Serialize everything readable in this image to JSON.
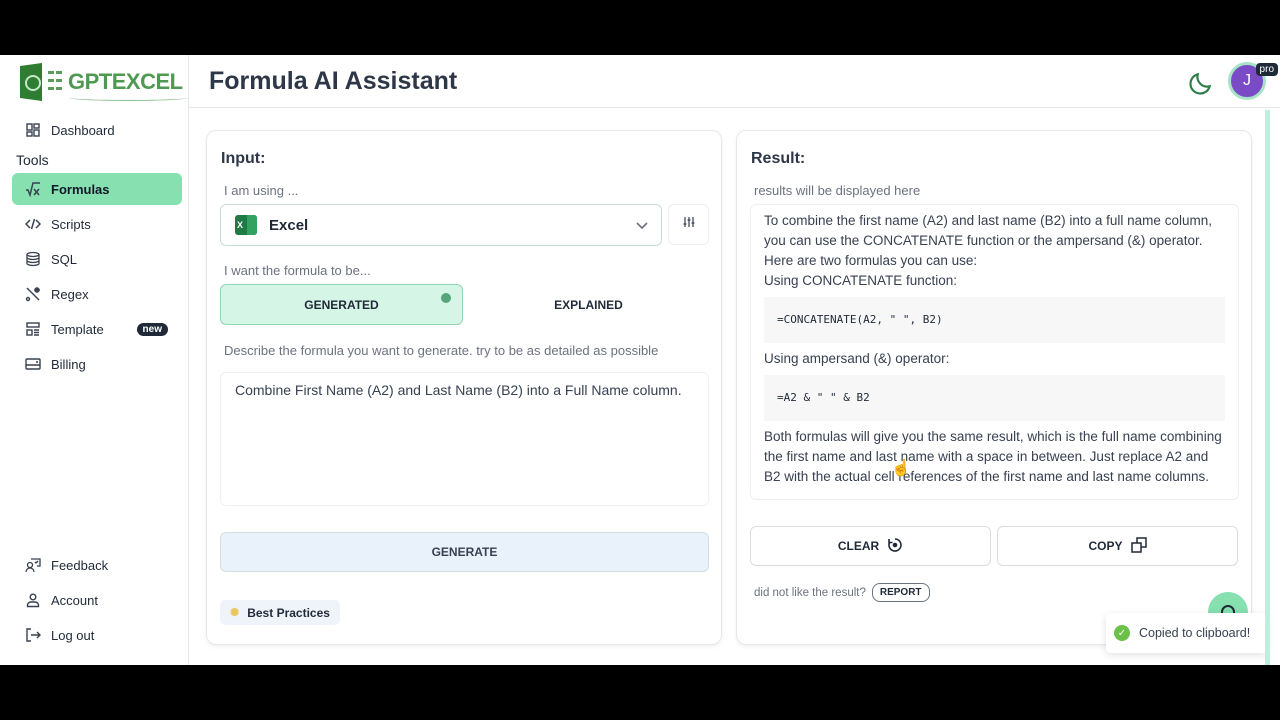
{
  "app": {
    "logo_text": "GPTEXCEL",
    "page_title": "Formula AI Assistant"
  },
  "sidebar": {
    "dashboard": "Dashboard",
    "section_label": "Tools",
    "items": [
      {
        "label": "Formulas",
        "icon": "sqrt-x-icon",
        "active": true
      },
      {
        "label": "Scripts",
        "icon": "code-icon"
      },
      {
        "label": "SQL",
        "icon": "database-icon"
      },
      {
        "label": "Regex",
        "icon": "regex-icon"
      },
      {
        "label": "Template",
        "icon": "template-icon",
        "badge": "new"
      },
      {
        "label": "Billing",
        "icon": "credit-card-icon"
      }
    ],
    "bottom": [
      {
        "label": "Feedback",
        "icon": "feedback-icon"
      },
      {
        "label": "Account",
        "icon": "user-icon"
      },
      {
        "label": "Log out",
        "icon": "logout-icon"
      }
    ]
  },
  "header": {
    "avatar_initial": "J",
    "pro_badge": "pro"
  },
  "input": {
    "title": "Input:",
    "using_label": "I am using ...",
    "selected_app": "Excel",
    "mode_label": "I want the formula to be...",
    "mode_generated": "GENERATED",
    "mode_explained": "EXPLAINED",
    "selected_mode": "GENERATED",
    "describe_label": "Describe the formula you want to generate. try to be as detailed as possible",
    "prompt_value": "Combine First Name (A2) and Last Name (B2) into a Full Name column.",
    "generate_label": "GENERATE",
    "best_practices_label": "Best Practices"
  },
  "result": {
    "title": "Result:",
    "hint": "results will be displayed here",
    "intro": "To combine the first name (A2) and last name (B2) into a full name column, you can use the CONCATENATE function or the ampersand (&) operator. Here are two formulas you can use:",
    "concat_heading": "Using CONCATENATE function:",
    "concat_code": "=CONCATENATE(A2, \" \", B2)",
    "amp_heading": "Using ampersand (&) operator:",
    "amp_code": "=A2 & \" \" & B2",
    "outro": "Both formulas will give you the same result, which is the full name combining the first name and last name with a space in between. Just replace A2 and B2 with the actual cell references of the first name and last name columns.",
    "clear_label": "CLEAR",
    "copy_label": "COPY",
    "report_prompt": "did not like the result?",
    "report_label": "REPORT"
  },
  "toast": {
    "message": "Copied to clipboard!"
  },
  "colors": {
    "accent": "#86e0b0",
    "brand": "#4f9a52",
    "avatar": "#7b4bc7"
  }
}
